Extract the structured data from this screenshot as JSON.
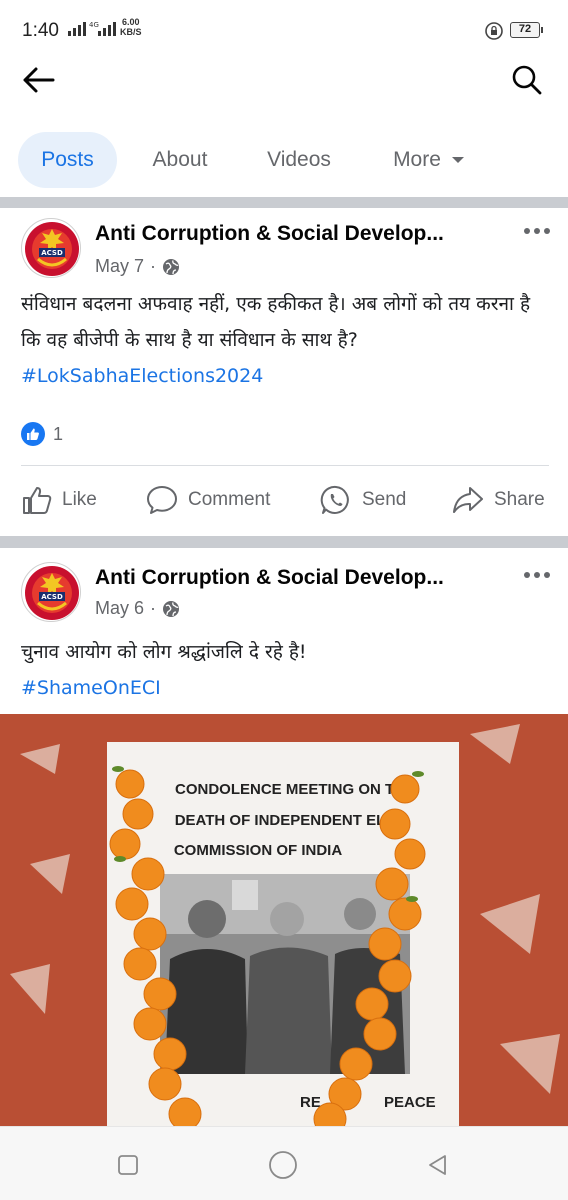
{
  "status_bar": {
    "time": "1:40",
    "network": "4G",
    "speed_value": "6.00",
    "speed_unit": "KB/S",
    "battery": "72"
  },
  "tabs": [
    {
      "label": "Posts",
      "active": true
    },
    {
      "label": "About",
      "active": false
    },
    {
      "label": "Videos",
      "active": false
    },
    {
      "label": "More",
      "active": false
    }
  ],
  "posts": [
    {
      "page_name": "Anti Corruption & Social Develop...",
      "avatar_text": "ACSD",
      "date": "May 7",
      "audience_icon": "globe-icon",
      "text": "संविधान बदलना अफवाह नहीं, एक हकीकत है। अब लोगों को तय करना है कि वह बीजेपी के साथ है या संविधान के साथ है?",
      "hashtag": "#LokSabhaElections2024",
      "reaction_count": "1",
      "actions": {
        "like": "Like",
        "comment": "Comment",
        "send": "Send",
        "share": "Share"
      }
    },
    {
      "page_name": "Anti Corruption & Social Develop...",
      "avatar_text": "ACSD",
      "date": "May 6",
      "audience_icon": "globe-icon",
      "text": "चुनाव आयोग को लोग श्रद्धांजलि दे रहे है!",
      "hashtag": "#ShameOnECI",
      "image": {
        "poster_line1": "CONDOLENCE MEETING ON TH",
        "poster_line2": "DEATH OF INDEPENDENT ELE",
        "poster_line3": "COMMISSION OF INDIA",
        "poster_bottom_left": "RE",
        "poster_bottom_right": "PEACE"
      }
    }
  ],
  "colors": {
    "accent": "#1b74e4",
    "text_primary": "#050505",
    "text_secondary": "#65676b",
    "separator": "#c9ccd1",
    "wall": "#b54a31",
    "marigold": "#f08c1e"
  }
}
